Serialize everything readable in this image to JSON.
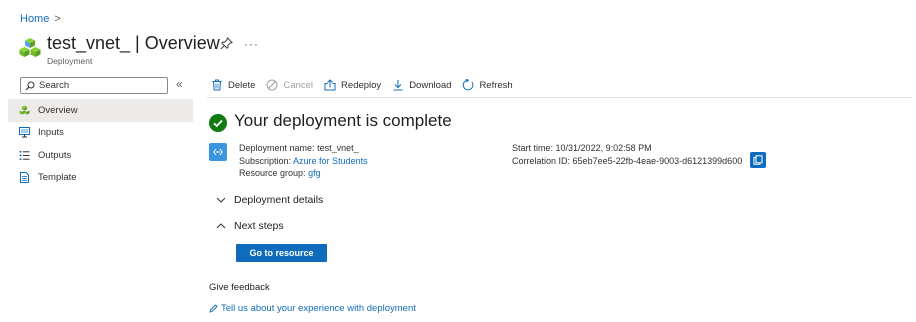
{
  "breadcrumb": {
    "home": "Home",
    "separator": ">"
  },
  "header": {
    "title": "test_vnet_ | Overview",
    "subtitle": "Deployment",
    "more_label": "···"
  },
  "sidebar": {
    "search_placeholder": "Search",
    "collapse_label": "«",
    "items": [
      {
        "label": "Overview",
        "icon": "deployment-icon",
        "active": true
      },
      {
        "label": "Inputs",
        "icon": "inputs-icon"
      },
      {
        "label": "Outputs",
        "icon": "outputs-icon"
      },
      {
        "label": "Template",
        "icon": "template-icon"
      }
    ]
  },
  "toolbar": {
    "delete": "Delete",
    "cancel": "Cancel",
    "redeploy": "Redeploy",
    "download": "Download",
    "refresh": "Refresh"
  },
  "status": {
    "title": "Your deployment is complete",
    "color": "#107c10"
  },
  "deployment": {
    "name_label": "Deployment name:",
    "name_value": "test_vnet_",
    "subscription_label": "Subscription:",
    "subscription_value": "Azure for Students",
    "resource_group_label": "Resource group:",
    "resource_group_value": "gfg",
    "start_time_label": "Start time:",
    "start_time_value": "10/31/2022, 9:02:58 PM",
    "correlation_label": "Correlation ID:",
    "correlation_value": "65eb7ee5-22fb-4eae-9003-d6121399d600"
  },
  "sections": {
    "deployment_details": "Deployment details",
    "next_steps": "Next steps",
    "go_to_resource": "Go to resource"
  },
  "feedback": {
    "title": "Give feedback",
    "link": "Tell us about your experience with deployment"
  },
  "colors": {
    "accent": "#0f6cbd",
    "success": "#107c10",
    "selected_nav": "#edebe9"
  }
}
